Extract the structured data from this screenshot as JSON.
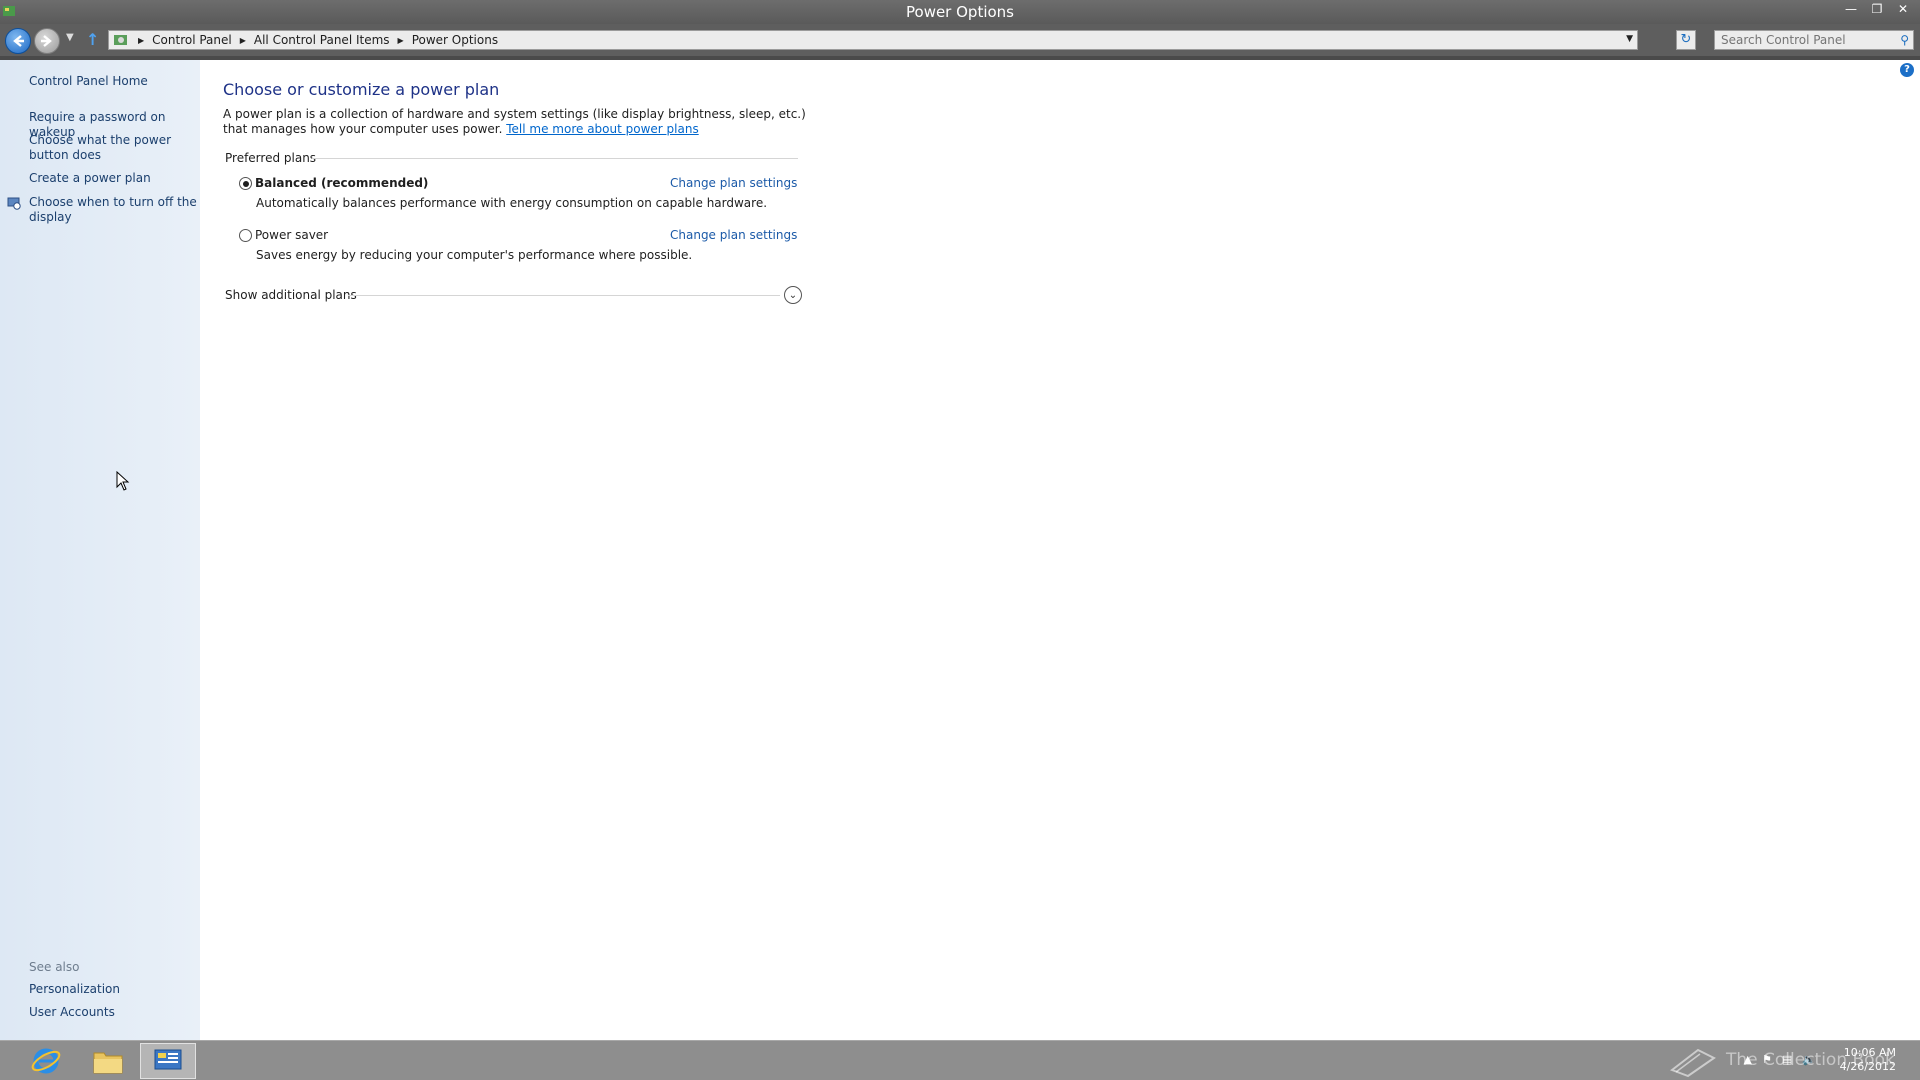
{
  "window": {
    "title": "Power Options"
  },
  "address_bar": {
    "crumbs": [
      "Control Panel",
      "All Control Panel Items",
      "Power Options"
    ],
    "search_placeholder": "Search Control Panel"
  },
  "sidebar": {
    "home": "Control Panel Home",
    "links": [
      "Require a password on wakeup",
      "Choose what the power button does",
      "Create a power plan",
      "Choose when to turn off the display"
    ],
    "see_also_label": "See also",
    "see_also": [
      "Personalization",
      "User Accounts"
    ]
  },
  "main": {
    "title": "Choose or customize a power plan",
    "intro": "A power plan is a collection of hardware and system settings (like display brightness, sleep, etc.) that manages how your computer uses power.",
    "intro_link": "Tell me more about power plans",
    "preferred_label": "Preferred plans",
    "plans": [
      {
        "name": "Balanced (recommended)",
        "desc": "Automatically balances performance with energy consumption on capable hardware.",
        "selected": true,
        "change_link": "Change plan settings"
      },
      {
        "name": "Power saver",
        "desc": "Saves energy by reducing your computer's performance where possible.",
        "selected": false,
        "change_link": "Change plan settings"
      }
    ],
    "show_more": "Show additional plans"
  },
  "taskbar": {
    "time": "10:06 AM",
    "date": "4/26/2012",
    "watermark": "The Collection Book"
  },
  "colors": {
    "link": "#1b5aa8",
    "title": "#1e3287",
    "sidebar_bg": "#e4edf7"
  }
}
